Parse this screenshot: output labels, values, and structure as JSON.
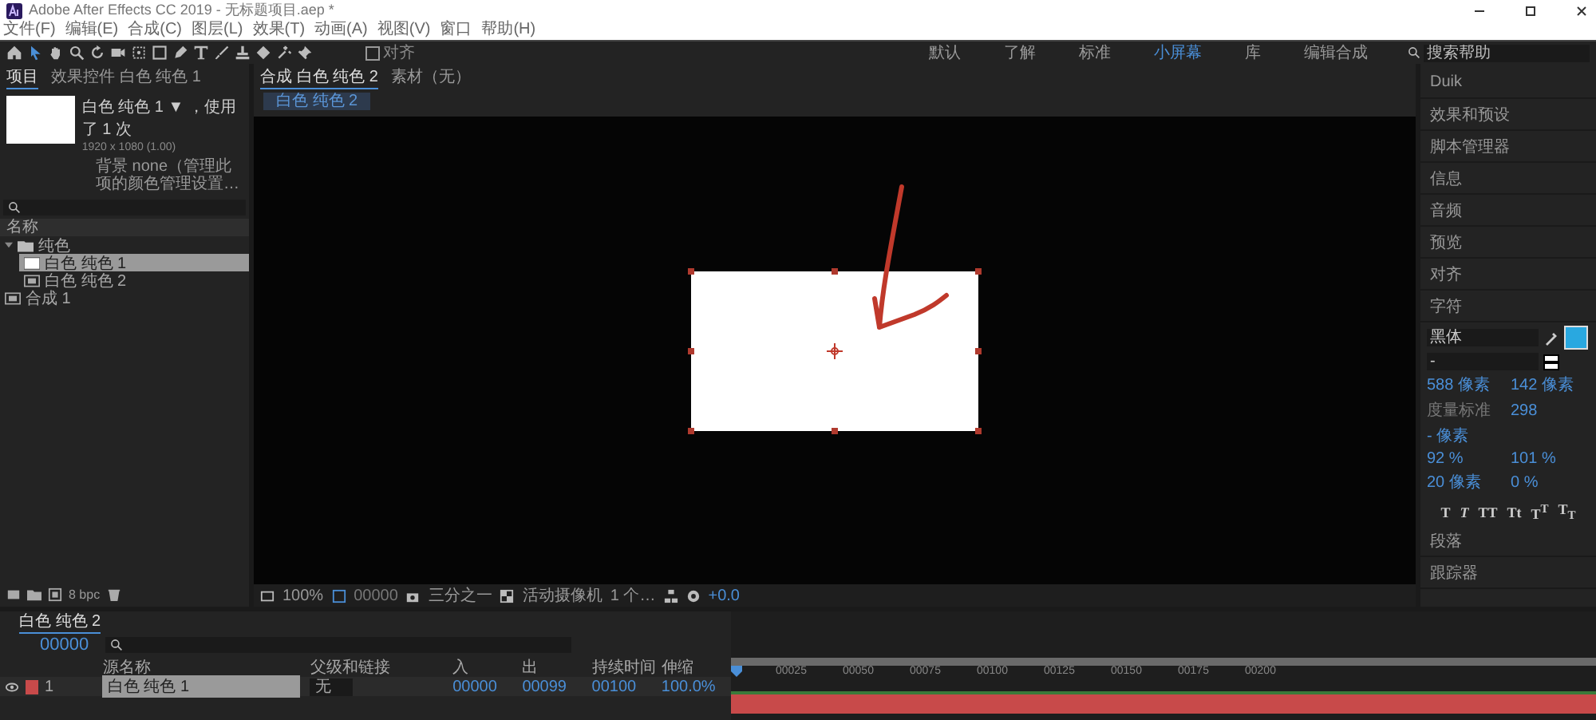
{
  "window": {
    "title": "Adobe After Effects CC 2019 - 无标题项目.aep *"
  },
  "menu": [
    "文件(F)",
    "编辑(E)",
    "合成(C)",
    "图层(L)",
    "效果(T)",
    "动画(A)",
    "视图(V)",
    "窗口",
    "帮助(H)"
  ],
  "toolbar": {
    "tools": [
      {
        "kind": "home",
        "selected": false
      },
      {
        "kind": "arrow",
        "selected": true
      },
      {
        "kind": "hand",
        "selected": false
      },
      {
        "kind": "zoom",
        "selected": false
      },
      {
        "kind": "rotate",
        "selected": false
      },
      {
        "kind": "camera",
        "selected": false
      },
      {
        "kind": "pan",
        "selected": false
      },
      {
        "kind": "rect",
        "selected": false
      },
      {
        "kind": "pen",
        "selected": false
      },
      {
        "kind": "type",
        "selected": false
      },
      {
        "kind": "brush",
        "selected": false
      },
      {
        "kind": "stamp",
        "selected": false
      },
      {
        "kind": "eraser",
        "selected": false
      },
      {
        "kind": "roto",
        "selected": false
      },
      {
        "kind": "pin",
        "selected": false
      }
    ],
    "snap": {
      "label": "对齐",
      "checked": false
    },
    "workspaces": [
      {
        "label": "默认",
        "selected": false
      },
      {
        "label": "了解",
        "selected": false
      },
      {
        "label": "标准",
        "selected": false
      },
      {
        "label": "小屏幕",
        "selected": true
      },
      {
        "label": "库",
        "selected": false
      },
      {
        "label": "编辑合成",
        "selected": false
      }
    ],
    "search": {
      "placeholder": "搜索帮助"
    }
  },
  "project_panel": {
    "tabs": [
      {
        "label": "项目",
        "selected": true
      },
      {
        "label": "效果控件 白色 纯色 1",
        "selected": false
      }
    ],
    "preview": {
      "name": "白色 纯色 1 ▼ ，使用了 1 次",
      "size": "1920 x 1080 (1.00)",
      "note": "背景 none（管理此项的颜色管理设置…"
    },
    "column": "名称",
    "tree": [
      {
        "label": "纯色",
        "kind": "folder",
        "selected": false,
        "expanded": true,
        "children": [
          {
            "label": "白色 纯色 1",
            "kind": "solid",
            "selected": true
          },
          {
            "label": "白色 纯色 2",
            "kind": "comp",
            "selected": false
          }
        ]
      },
      {
        "label": "合成 1",
        "kind": "comp",
        "selected": false
      }
    ],
    "bit_depth": "8 bpc"
  },
  "composition_panel": {
    "tabs": [
      {
        "label": "合成 白色 纯色 2",
        "selected": true
      },
      {
        "label": "素材（无）",
        "selected": false
      }
    ],
    "breadcrumb": "白色 纯色 2",
    "controls": {
      "zoom": "100%",
      "timecode": "00000",
      "resolution": "三分之一",
      "camera": "活动摄像机",
      "views": "1 个…",
      "exposure": "+0.0"
    }
  },
  "right_panel": [
    {
      "label": "Duik",
      "expanded": false
    },
    {
      "label": "效果和预设",
      "expanded": false
    },
    {
      "label": "脚本管理器",
      "expanded": false
    },
    {
      "label": "信息",
      "expanded": false
    },
    {
      "label": "音频",
      "expanded": false
    },
    {
      "label": "预览",
      "expanded": false
    },
    {
      "label": "对齐",
      "expanded": false
    },
    {
      "label": "字符",
      "expanded": true
    },
    {
      "label": "段落",
      "expanded": false
    },
    {
      "label": "跟踪器",
      "expanded": false
    }
  ],
  "character": {
    "font": "黑体",
    "style": "-",
    "size": "588 像素",
    "leading": "142 像素",
    "kerning": "度量标准",
    "tracking": "298",
    "stroke_width": "- 像素",
    "vertical_scale": "92 %",
    "horizontal_scale": "101 %",
    "baseline_shift": "20 像素",
    "tsume": "0 %",
    "styles": [
      "T",
      "*T*",
      "TT",
      "Tt",
      "T$^{T}$",
      "T$_{T}$"
    ]
  },
  "timeline": {
    "tab": "白色 纯色 2",
    "timecode": "00000",
    "columns": [
      "源名称",
      "父级和链接",
      "入",
      "出",
      "持续时间",
      "伸缩"
    ],
    "layers": [
      {
        "number": "1",
        "name": "白色 纯色 1",
        "parent": "无",
        "in": "00000",
        "out": "00099",
        "duration": "00100",
        "stretch": "100.0%",
        "color": "#c84a4a"
      }
    ],
    "ruler": [
      "00025",
      "00050",
      "00075",
      "00100",
      "00125",
      "00150",
      "00175",
      "00200"
    ]
  }
}
